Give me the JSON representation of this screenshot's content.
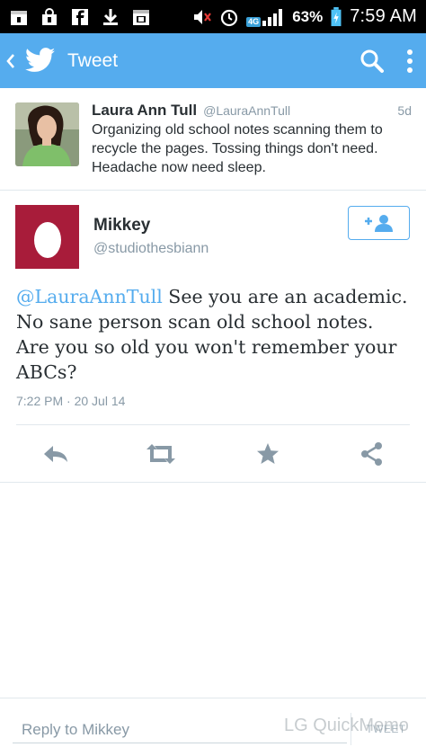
{
  "status_bar": {
    "network_badge": "4G",
    "battery_percent": "63%",
    "time": "7:59 AM"
  },
  "app_bar": {
    "title": "Tweet",
    "color": "#55acee"
  },
  "parent_tweet": {
    "name": "Laura Ann Tull",
    "handle": "@LauraAnnTull",
    "time_ago": "5d",
    "text": "Organizing old school notes scanning them to recycle the pages. Tossing things don't need.  Headache now need sleep."
  },
  "main_tweet": {
    "name": "Mikkey",
    "handle": "@studiothesbiann",
    "mention": "@LauraAnnTull",
    "text_body": " See you are an academic. No sane person scan old school notes. Are you so old you won't remember your ABCs?",
    "timestamp": "7:22 PM · 20 Jul 14",
    "avatar_color": "#a81c3a"
  },
  "reply_bar": {
    "placeholder": "Reply to Mikkey",
    "send_label": "TWEET"
  },
  "watermark": "LG QuickMemo"
}
